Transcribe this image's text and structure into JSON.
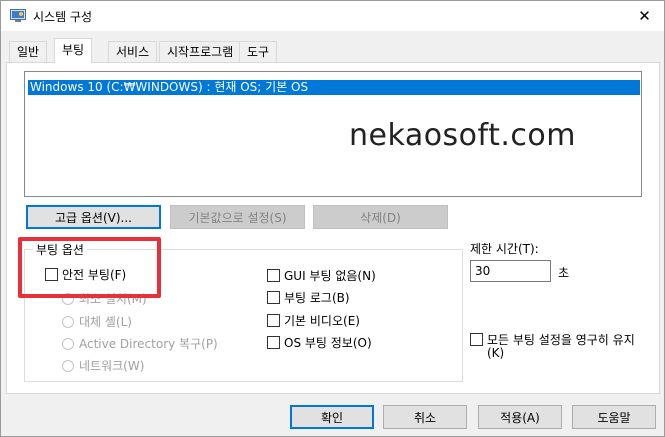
{
  "window": {
    "title": "시스템 구성",
    "close": "✕"
  },
  "tabs": [
    {
      "label": "일반"
    },
    {
      "label": "부팅"
    },
    {
      "label": "서비스"
    },
    {
      "label": "시작프로그램"
    },
    {
      "label": "도구"
    }
  ],
  "os_list": {
    "items": [
      "Windows 10 (C:₩WINDOWS) : 현재 OS; 기본 OS"
    ]
  },
  "watermark": "nekaosoft.com",
  "buttons": {
    "advanced": "고급 옵션(V)...",
    "set_default": "기본값으로 설정(S)",
    "delete": "삭제(D)",
    "ok": "확인",
    "cancel": "취소",
    "apply": "적용(A)",
    "help": "도움말"
  },
  "boot_options": {
    "title": "부팅 옵션",
    "safe_boot": "안전 부팅(F)",
    "minimal": "최소 설치(M)",
    "alternate_shell": "대체 셸(L)",
    "ad_repair": "Active Directory 복구(P)",
    "network": "네트워크(W)",
    "no_gui": "GUI 부팅 없음(N)",
    "boot_log": "부팅 로그(B)",
    "base_video": "기본 비디오(E)",
    "os_boot_info": "OS 부팅 정보(O)"
  },
  "timeout": {
    "label": "제한 시간(T):",
    "value": "30",
    "unit": "초"
  },
  "permanent": {
    "label_line1": "모든 부팅 설정을 영구히 유지",
    "label_line2": "(K)"
  }
}
